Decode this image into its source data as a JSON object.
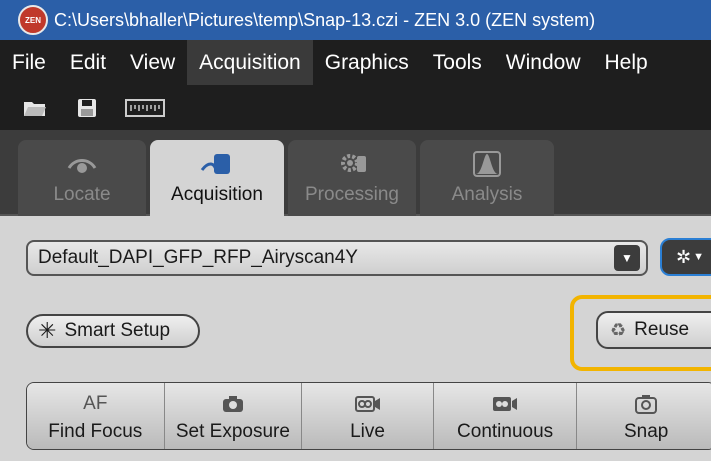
{
  "window": {
    "title": "C:\\Users\\bhaller\\Pictures\\temp\\Snap-13.czi - ZEN 3.0 (ZEN system)",
    "logo_text": "ZEN"
  },
  "menu": {
    "items": [
      "File",
      "Edit",
      "View",
      "Acquisition",
      "Graphics",
      "Tools",
      "Window",
      "Help"
    ],
    "active": "Acquisition"
  },
  "toolbar": {
    "icons": [
      "open-folder-icon",
      "save-icon",
      "scalebar-icon"
    ]
  },
  "tabs": [
    {
      "label": "Locate",
      "icon": "eye-icon"
    },
    {
      "label": "Acquisition",
      "icon": "acquire-icon"
    },
    {
      "label": "Processing",
      "icon": "gear-icon"
    },
    {
      "label": "Analysis",
      "icon": "peak-icon"
    }
  ],
  "active_tab": "Acquisition",
  "experiment": {
    "selected": "Default_DAPI_GFP_RFP_Airyscan4Y"
  },
  "buttons": {
    "smart_setup": "Smart Setup",
    "reuse": "Reuse"
  },
  "actions": [
    {
      "top": "AF",
      "label": "Find Focus"
    },
    {
      "top": "",
      "label": "Set Exposure"
    },
    {
      "top": "",
      "label": "Live"
    },
    {
      "top": "",
      "label": "Continuous"
    },
    {
      "top": "",
      "label": "Snap"
    }
  ],
  "colors": {
    "title_bar": "#2b5fa8",
    "menu_bar": "#1e1e1e",
    "highlight": "#f2b400",
    "accent_border": "#2b7fd4"
  }
}
